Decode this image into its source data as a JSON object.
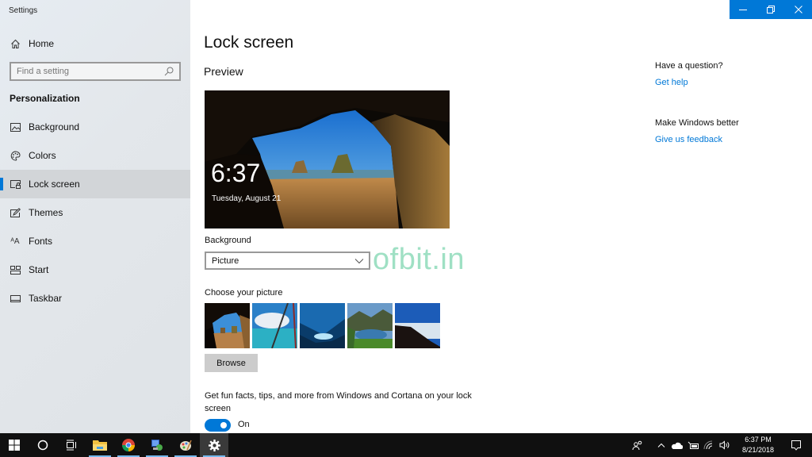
{
  "window": {
    "app_title": "Settings",
    "controls": {
      "minimize": "minimize",
      "restore": "restore",
      "close": "close"
    },
    "accent_color": "#0078d7"
  },
  "sidebar": {
    "home_label": "Home",
    "search_placeholder": "Find a setting",
    "section_title": "Personalization",
    "items": [
      {
        "label": "Background",
        "icon": "picture-icon",
        "active": false
      },
      {
        "label": "Colors",
        "icon": "palette-icon",
        "active": false
      },
      {
        "label": "Lock screen",
        "icon": "lock-screen-icon",
        "active": true
      },
      {
        "label": "Themes",
        "icon": "themes-icon",
        "active": false
      },
      {
        "label": "Fonts",
        "icon": "fonts-icon",
        "active": false
      },
      {
        "label": "Start",
        "icon": "start-icon",
        "active": false
      },
      {
        "label": "Taskbar",
        "icon": "taskbar-icon",
        "active": false
      }
    ]
  },
  "main": {
    "title": "Lock screen",
    "preview_label": "Preview",
    "preview_time": "6:37",
    "preview_date": "Tuesday, August 21",
    "background_label": "Background",
    "background_value": "Picture",
    "watermark": "ofbit.in",
    "choose_label": "Choose your picture",
    "thumbnails": [
      "cave-beach",
      "clouds-lake",
      "ice-cave",
      "mountain-lake",
      "mountain-clouds"
    ],
    "browse_label": "Browse",
    "tips_text": "Get fun facts, tips, and more from Windows and Cortana on your lock screen",
    "toggle_state": "On"
  },
  "aside": {
    "question": "Have a question?",
    "help_link": "Get help",
    "feedback_question": "Make Windows better",
    "feedback_link": "Give us feedback"
  },
  "taskbar": {
    "pinned": [
      "start",
      "cortana-search",
      "task-view",
      "file-explorer",
      "chrome",
      "network-app",
      "paint-app",
      "settings"
    ],
    "clock_time": "6:37 PM",
    "clock_date": "8/21/2018"
  }
}
